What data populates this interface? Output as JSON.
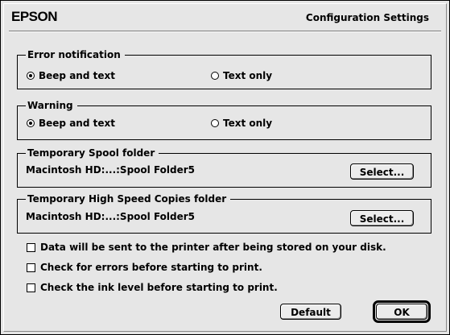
{
  "brand": "EPSON",
  "dialog_title": "Configuration Settings",
  "error_notification": {
    "legend": "Error notification",
    "option_beep": "Beep and text",
    "option_text": "Text only",
    "selected": "beep"
  },
  "warning": {
    "legend": "Warning",
    "option_beep": "Beep and text",
    "option_text": "Text only",
    "selected": "beep"
  },
  "spool_folder": {
    "legend": "Temporary Spool folder",
    "path": "Macintosh HD:...:Spool Folder5",
    "button": "Select..."
  },
  "copies_folder": {
    "legend": "Temporary High Speed Copies folder",
    "path": "Macintosh HD:...:Spool Folder5",
    "button": "Select..."
  },
  "options": [
    {
      "label": "Data will be sent to the printer after being stored on your disk.",
      "checked": false
    },
    {
      "label": "Check for errors before starting to print.",
      "checked": false
    },
    {
      "label": "Check the ink level before starting to print.",
      "checked": false
    }
  ],
  "buttons": {
    "default": "Default",
    "ok": "OK"
  }
}
